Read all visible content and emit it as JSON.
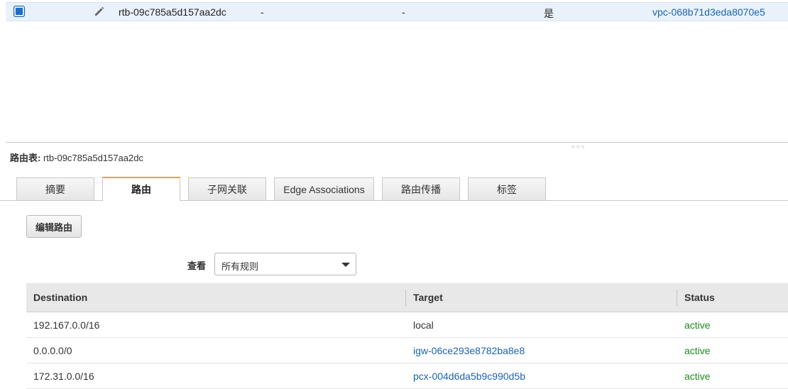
{
  "selected_row": {
    "id": "rtb-09c785a5d157aa2dc",
    "col_a": "-",
    "col_b": "-",
    "main": "是",
    "vpc": "vpc-068b71d3eda8070e5"
  },
  "detail": {
    "label": "路由表:",
    "value": "rtb-09c785a5d157aa2dc"
  },
  "tabs": [
    {
      "label": "摘要"
    },
    {
      "label": "路由"
    },
    {
      "label": "子网关联"
    },
    {
      "label": "Edge Associations"
    },
    {
      "label": "路由传播"
    },
    {
      "label": "标签"
    }
  ],
  "active_tab": "路由",
  "edit_button": "编辑路由",
  "filter": {
    "label": "查看",
    "value": "所有规则"
  },
  "table": {
    "headers": {
      "destination": "Destination",
      "target": "Target",
      "status": "Status"
    },
    "rows": [
      {
        "destination": "192.167.0.0/16",
        "target": "local",
        "status": "active"
      },
      {
        "destination": "0.0.0.0/0",
        "target": "igw-06ce293e8782ba8e8",
        "status": "active"
      },
      {
        "destination": "172.31.0.0/16",
        "target": "pcx-004d6da5b9c990d5b",
        "status": "active"
      }
    ]
  },
  "colors": {
    "accent_tab": "#f0a31e",
    "link": "#1a64b0",
    "status_active": "#1d8a1d",
    "selected_row_bg": "#e9f2fb"
  },
  "icons": [
    "checkbox-checked-icon",
    "pencil-icon",
    "resize-grip-icon",
    "chevron-down-icon"
  ]
}
